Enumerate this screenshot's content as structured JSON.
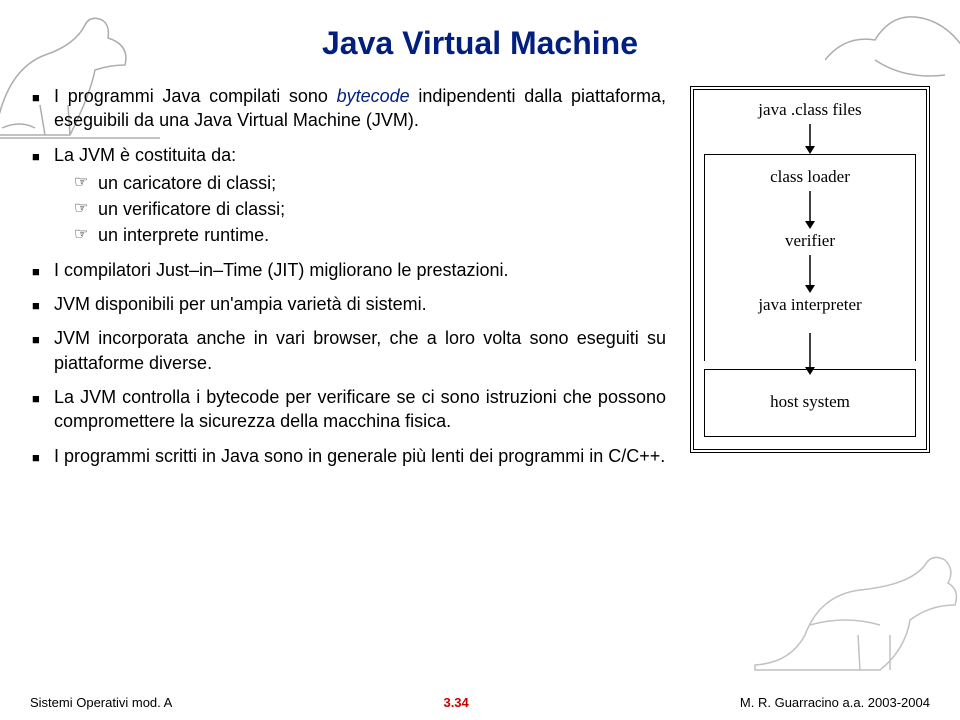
{
  "title": "Java Virtual Machine",
  "bullets": {
    "b1_pre": "I programmi Java compilati sono ",
    "b1_em": "bytecode",
    "b1_post": " indipendenti dalla piattaforma, eseguibili da una Java Virtual Machine (JVM).",
    "b2": "La JVM è costituita da:",
    "b2a": "un caricatore di classi;",
    "b2b": "un verificatore di classi;",
    "b2c": "un interprete runtime.",
    "b3": "I compilatori Just–in–Time (JIT) migliorano le prestazioni.",
    "b4": "JVM disponibili per un'ampia varietà di sistemi.",
    "b5": "JVM incorporata anche in vari browser, che a loro volta sono eseguiti su piattaforme diverse.",
    "b6": "La JVM controlla i bytecode per verificare se ci sono istruzioni che possono compromettere la sicurezza della macchina fisica.",
    "b7": "I programmi scritti in Java sono in generale più lenti dei programmi in C/C++."
  },
  "diagram": {
    "top": "java .class files",
    "loader": "class loader",
    "verifier": "verifier",
    "interpreter": "java interpreter",
    "host": "host system"
  },
  "footer": {
    "left": "Sistemi Operativi mod. A",
    "center": "3.34",
    "right": "M. R. Guarracino a.a. 2003-2004"
  }
}
